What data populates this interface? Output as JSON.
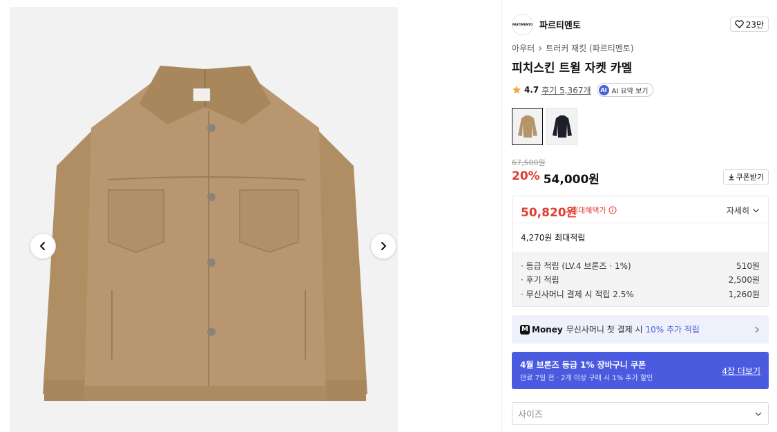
{
  "brand": {
    "logo_text": "PARTIMENTO",
    "name": "파르티멘토",
    "likes": "23만"
  },
  "breadcrumb": {
    "category": "아우터",
    "subcategory": "트러커 재킷 (파르티멘토)"
  },
  "product": {
    "title": "피치스킨 트윌 자켓 카멜",
    "rating": "4.7",
    "reviews_label": "후기 5,367개",
    "ai_badge": "AI",
    "ai_summary_label": "AI 요약 보기",
    "colors": [
      "#b4956a",
      "#1c1f2a"
    ]
  },
  "pricing": {
    "original_price": "67,500원",
    "discount": "20%",
    "sale_price": "54,000원",
    "coupon_button": "쿠폰받기"
  },
  "benefit": {
    "max_price": "50,820원",
    "max_label": "최대혜택가",
    "detail_label": "자세히",
    "points_title": "4,270원 최대적립",
    "points": [
      {
        "label": "· 등급 적립 (LV.4 브론즈 · 1%)",
        "value": "510원"
      },
      {
        "label": "· 후기 적립",
        "value": "2,500원"
      },
      {
        "label": "· 무신사머니 결제 시 적립 2.5%",
        "value": "1,260원"
      }
    ]
  },
  "money_banner": {
    "logo_letter": "M",
    "logo_text": "Money",
    "text": "무신사머니 첫 결제 시",
    "accent": "10% 추가 적립"
  },
  "coupon_banner": {
    "title": "4월 브론즈 등급 1% 장바구니 쿠폰",
    "subtitle": "만료 7일 전 · 2개 이상 구매 시 1% 추가 할인",
    "link": "4장 더보기"
  },
  "size_select": {
    "placeholder": "사이즈"
  },
  "colors": {
    "accent_red": "#e03c31",
    "accent_blue": "#4a5be0",
    "camel": "#b4956a"
  }
}
